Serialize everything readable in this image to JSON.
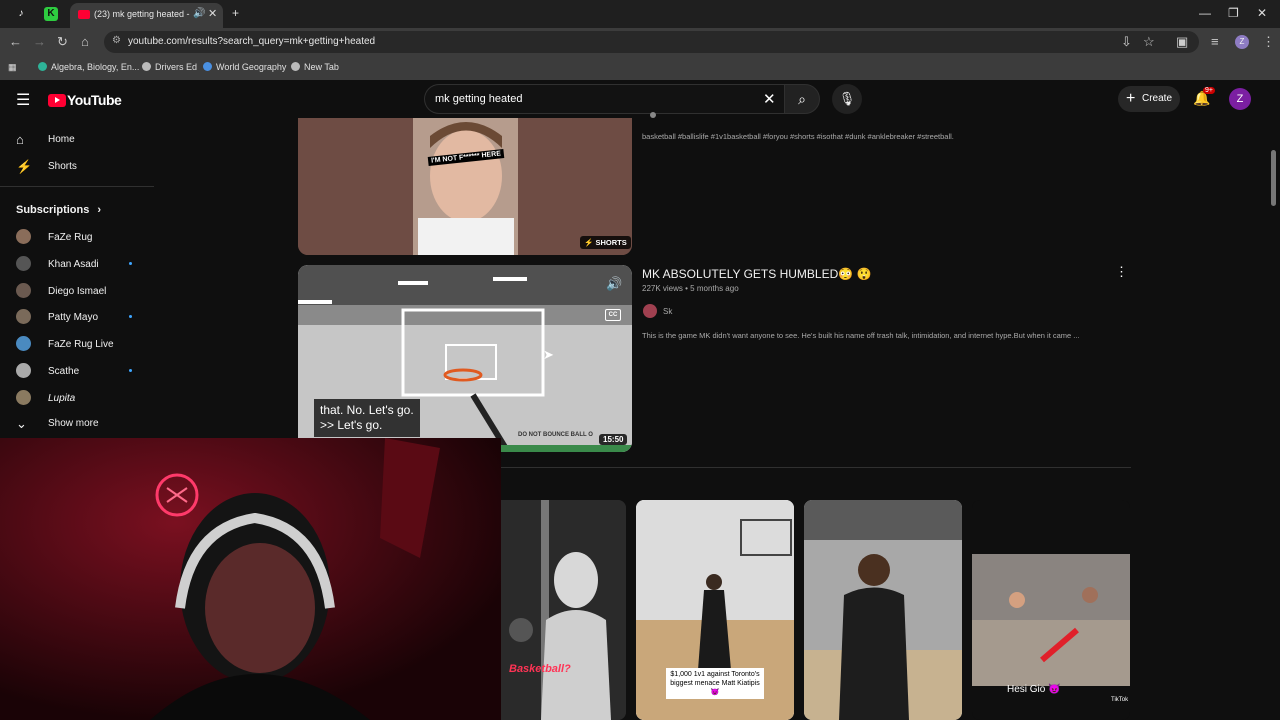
{
  "browser": {
    "tab_title": "(23) mk getting heated - Yo",
    "url": "youtube.com/results?search_query=mk+getting+heated",
    "bookmarks": [
      "Algebra, Biology, En...",
      "Drivers Ed",
      "World Geography",
      "New Tab"
    ],
    "profile_initial": "Z"
  },
  "header": {
    "logo_text": "YouTube",
    "search_query": "mk getting heated",
    "create_label": "Create",
    "notif_badge": "9+",
    "avatar_initial": "Z"
  },
  "sidebar": {
    "items": [
      {
        "label": "Home",
        "icon": "home-icon"
      },
      {
        "label": "Shorts",
        "icon": "shorts-icon"
      }
    ],
    "subscriptions_label": "Subscriptions",
    "subscriptions": [
      {
        "name": "FaZe Rug",
        "live": false,
        "color": "#8a6d5a"
      },
      {
        "name": "Khan Asadi",
        "live": true,
        "color": "#555"
      },
      {
        "name": "Diego Ismael",
        "live": false,
        "color": "#6b5a50"
      },
      {
        "name": "Patty Mayo",
        "live": true,
        "color": "#7a6a5a"
      },
      {
        "name": "FaZe Rug Live",
        "live": false,
        "color": "#4a8ac0"
      },
      {
        "name": "Scathe",
        "live": true,
        "color": "#aaaaaa"
      },
      {
        "name": "Lupita",
        "live": false,
        "color": "#8a7a60"
      }
    ],
    "show_more": "Show more"
  },
  "results": {
    "first_desc": "basketball #ballislife #1v1basketball #foryou #shorts #isothat #dunk #anklebreaker #streetball.",
    "first_badge": "SHORTS",
    "first_thumb_text": "I'M NOT F****** HERE",
    "second": {
      "title": "MK ABSOLUTELY GETS HUMBLED😳 😲",
      "views": "227K views",
      "age": "5 months ago",
      "channel": "Sk",
      "description": "This is the game MK didn't want anyone to see. He's built his name off trash talk, intimidation, and internet hype.But when it came ...",
      "duration": "15:50",
      "captions": [
        "that. No. Let's go.",
        ">> Let's go."
      ],
      "cc_label": "CC",
      "sign_text": "DO NOT BOUNCE BALL O"
    }
  },
  "shorts_row": [
    {
      "overlay": "Basketball?"
    },
    {
      "overlay": "$1,000 1v1 against Toronto's biggest menace Matt Kiatipis😈"
    },
    {
      "overlay": ""
    },
    {
      "overlay": "Hesi Gio 😈",
      "watermark": "TikTok"
    }
  ]
}
